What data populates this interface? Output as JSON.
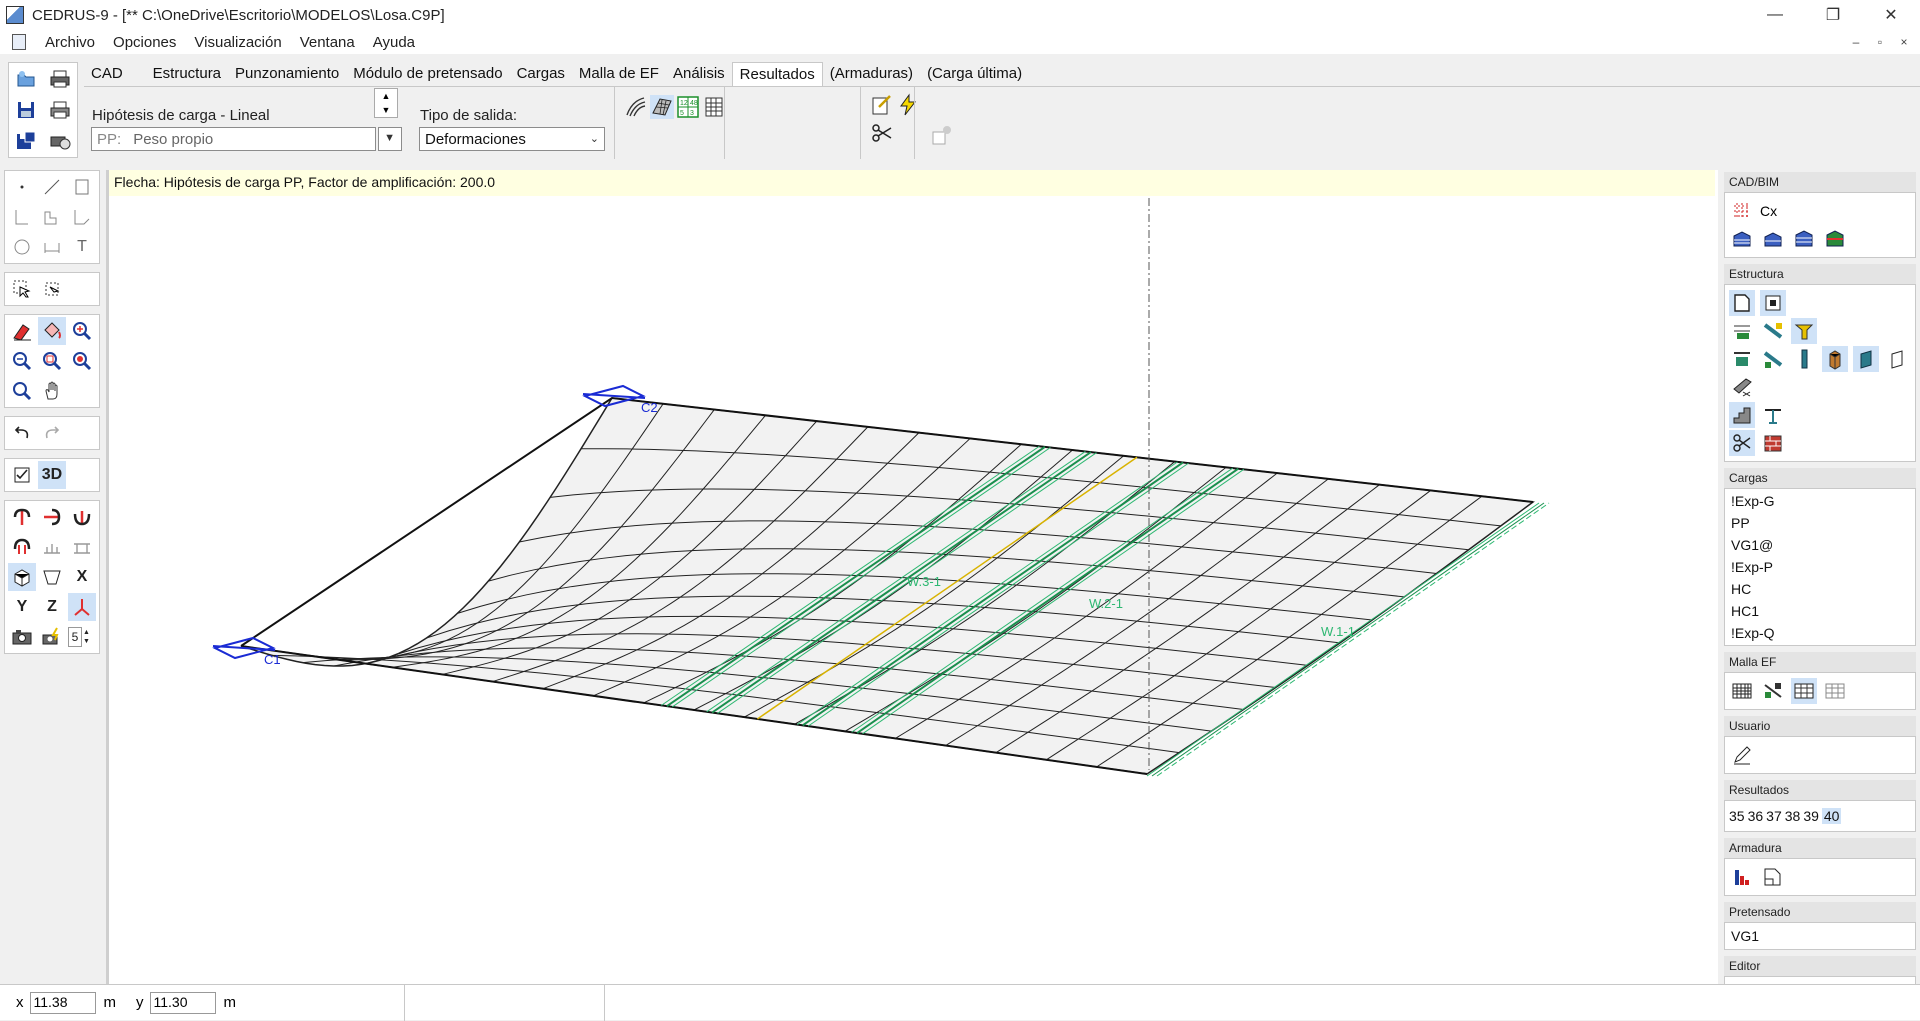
{
  "window": {
    "title": "CEDRUS-9 - [** C:\\OneDrive\\Escritorio\\MODELOS\\Losa.C9P]",
    "minimize": "—",
    "restore": "❐",
    "close": "✕"
  },
  "menu": [
    "Archivo",
    "Opciones",
    "Visualización",
    "Ventana",
    "Ayuda"
  ],
  "mdi": {
    "minimize": "–",
    "restore": "▫",
    "close": "×"
  },
  "tabs": [
    {
      "label": "CAD"
    },
    {
      "label": "Estructura"
    },
    {
      "label": "Punzonamiento"
    },
    {
      "label": "Módulo de pretensado"
    },
    {
      "label": "Cargas"
    },
    {
      "label": "Malla de EF"
    },
    {
      "label": "Análisis"
    },
    {
      "label": "Resultados",
      "active": true
    },
    {
      "label": "(Armaduras)"
    },
    {
      "label": "(Carga última)"
    }
  ],
  "ribbon": {
    "load_hypothesis_label": "Hipótesis de carga - Lineal",
    "load_hypothesis_prefix": "PP:",
    "load_hypothesis_value": "Peso propio",
    "output_type_label": "Tipo de salida:",
    "output_type_value": "Deformaciones"
  },
  "left_tools": {
    "text_tool": "T",
    "view_3d": "3D",
    "axis_x": "X",
    "axis_y": "Y",
    "axis_z": "Z",
    "spin_value": "5"
  },
  "canvas": {
    "banner": "Flecha: Hipótesis de carga PP, Factor de amplificación: 200.0",
    "labels": {
      "c1": "C1",
      "c2": "C2",
      "w31": "W.3-1",
      "w21": "W.2-1",
      "w11": "W.1-1"
    }
  },
  "right_panel": {
    "cad_bim": {
      "title": "CAD/BIM",
      "cx": "Cx"
    },
    "estructura": {
      "title": "Estructura"
    },
    "cargas": {
      "title": "Cargas",
      "items": [
        "!Exp-G",
        "PP",
        "VG1@",
        "!Exp-P",
        "HC",
        "HC1",
        "!Exp-Q"
      ]
    },
    "malla": {
      "title": "Malla EF"
    },
    "usuario": {
      "title": "Usuario"
    },
    "resultados": {
      "title": "Resultados",
      "numbers": [
        "35",
        "36",
        "37",
        "38",
        "39",
        "40"
      ],
      "selected": "40"
    },
    "armadura": {
      "title": "Armadura"
    },
    "pretensado": {
      "title": "Pretensado",
      "value": "VG1"
    },
    "editor": {
      "title": "Editor"
    }
  },
  "status": {
    "x_label": "x",
    "x_value": "11.38",
    "x_unit": "m",
    "y_label": "y",
    "y_value": "11.30",
    "y_unit": "m"
  },
  "colors": {
    "accent": "#cfe2f7",
    "banner": "#ffffe1",
    "column": "#1a2bd4",
    "beam": "#2eb872",
    "tendon": "#d9b300"
  }
}
